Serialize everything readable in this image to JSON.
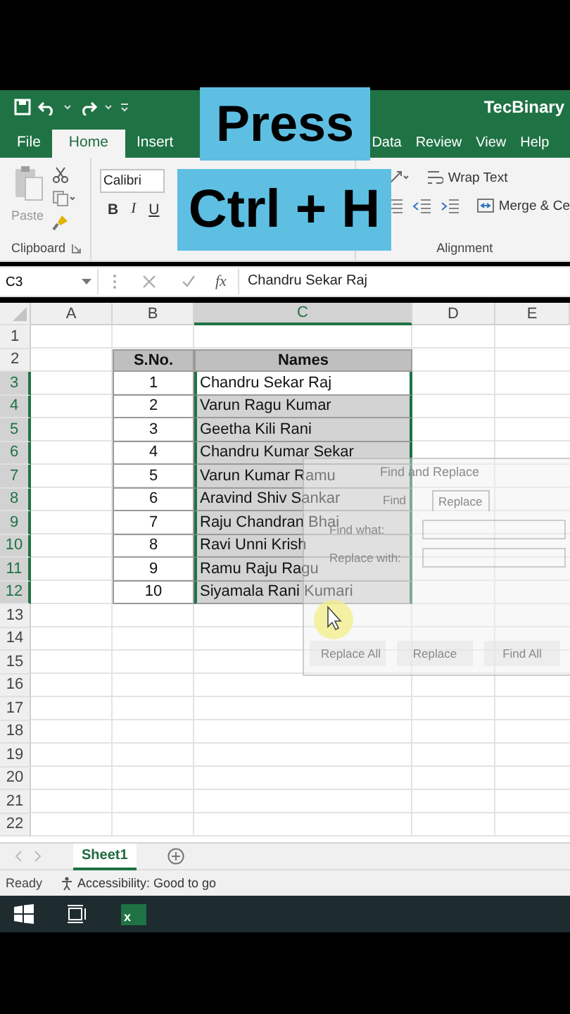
{
  "captions": [
    {
      "text": "Press"
    },
    {
      "text": "Ctrl + H"
    }
  ],
  "title_bar": {
    "app_name": "TecBinary"
  },
  "ribbon_tabs": [
    {
      "label": "File",
      "selected": false
    },
    {
      "label": "Home",
      "selected": true
    },
    {
      "label": "Insert",
      "selected": false
    },
    {
      "label": "Data",
      "selected": false
    },
    {
      "label": "Review",
      "selected": false
    },
    {
      "label": "View",
      "selected": false
    },
    {
      "label": "Help",
      "selected": false
    }
  ],
  "ribbon": {
    "clipboard": {
      "paste_label": "Paste",
      "group_label": "Clipboard"
    },
    "font": {
      "font_name": "Calibri",
      "style_buttons": [
        "B",
        "I",
        "U"
      ]
    },
    "alignment": {
      "wrap_text": "Wrap Text",
      "merge": "Merge & Ce",
      "group_label": "Alignment"
    }
  },
  "formula_bar": {
    "name_box": "C3",
    "function_label": "fx",
    "value": "Chandru Sekar Raj"
  },
  "columns": [
    {
      "label": "A",
      "selected": false
    },
    {
      "label": "B",
      "selected": false
    },
    {
      "label": "C",
      "selected": true
    },
    {
      "label": "D",
      "selected": false
    },
    {
      "label": "E",
      "selected": false
    }
  ],
  "rows": [
    {
      "number": "1",
      "selected": false
    },
    {
      "number": "2",
      "selected": false,
      "kind": "header",
      "sno": {
        "text": "S.No."
      },
      "name": {
        "text": "Names",
        "selected": false,
        "active": false
      }
    },
    {
      "number": "3",
      "selected": true,
      "kind": "data",
      "sno": {
        "text": "1"
      },
      "name": {
        "text": "Chandru Sekar Raj",
        "selected": true,
        "active": true
      }
    },
    {
      "number": "4",
      "selected": true,
      "kind": "data",
      "sno": {
        "text": "2"
      },
      "name": {
        "text": "Varun Ragu Kumar",
        "selected": true,
        "active": false
      }
    },
    {
      "number": "5",
      "selected": true,
      "kind": "data",
      "sno": {
        "text": "3"
      },
      "name": {
        "text": "Geetha Kili Rani",
        "selected": true,
        "active": false
      }
    },
    {
      "number": "6",
      "selected": true,
      "kind": "data",
      "sno": {
        "text": "4"
      },
      "name": {
        "text": "Chandru Kumar Sekar",
        "selected": true,
        "active": false
      }
    },
    {
      "number": "7",
      "selected": true,
      "kind": "data",
      "sno": {
        "text": "5"
      },
      "name": {
        "text": "Varun Kumar Ramu",
        "selected": true,
        "active": false
      }
    },
    {
      "number": "8",
      "selected": true,
      "kind": "data",
      "sno": {
        "text": "6"
      },
      "name": {
        "text": "Aravind Shiv Sankar",
        "selected": true,
        "active": false
      }
    },
    {
      "number": "9",
      "selected": true,
      "kind": "data",
      "sno": {
        "text": "7"
      },
      "name": {
        "text": "Raju Chandran Bhai",
        "selected": true,
        "active": false
      }
    },
    {
      "number": "10",
      "selected": true,
      "kind": "data",
      "sno": {
        "text": "8"
      },
      "name": {
        "text": "Ravi Unni Krish",
        "selected": true,
        "active": false
      }
    },
    {
      "number": "11",
      "selected": true,
      "kind": "data",
      "sno": {
        "text": "9"
      },
      "name": {
        "text": "Ramu Raju Ragu",
        "selected": true,
        "active": false
      }
    },
    {
      "number": "12",
      "selected": true,
      "kind": "data",
      "sno": {
        "text": "10"
      },
      "name": {
        "text": "Siyamala Rani Kumari",
        "selected": true,
        "active": false
      }
    },
    {
      "number": "13",
      "selected": false
    },
    {
      "number": "14",
      "selected": false
    },
    {
      "number": "15",
      "selected": false
    },
    {
      "number": "16",
      "selected": false
    },
    {
      "number": "17",
      "selected": false
    },
    {
      "number": "18",
      "selected": false
    },
    {
      "number": "19",
      "selected": false
    },
    {
      "number": "20",
      "selected": false
    },
    {
      "number": "21",
      "selected": false
    },
    {
      "number": "22",
      "selected": false
    }
  ],
  "dialog": {
    "title": "Find and Replace",
    "tabs": [
      {
        "label": "Find",
        "selected": false
      },
      {
        "label": "Replace",
        "selected": true
      }
    ],
    "find_label": "Find what:",
    "replace_label": "Replace with:",
    "buttons": [
      "Replace All",
      "Replace",
      "Find All"
    ]
  },
  "sheet_tabs": [
    {
      "label": "Sheet1",
      "selected": true
    }
  ],
  "status_bar": {
    "mode": "Ready",
    "accessibility": "Accessibility: Good to go"
  },
  "taskbar": {
    "excel_badge": "x"
  }
}
